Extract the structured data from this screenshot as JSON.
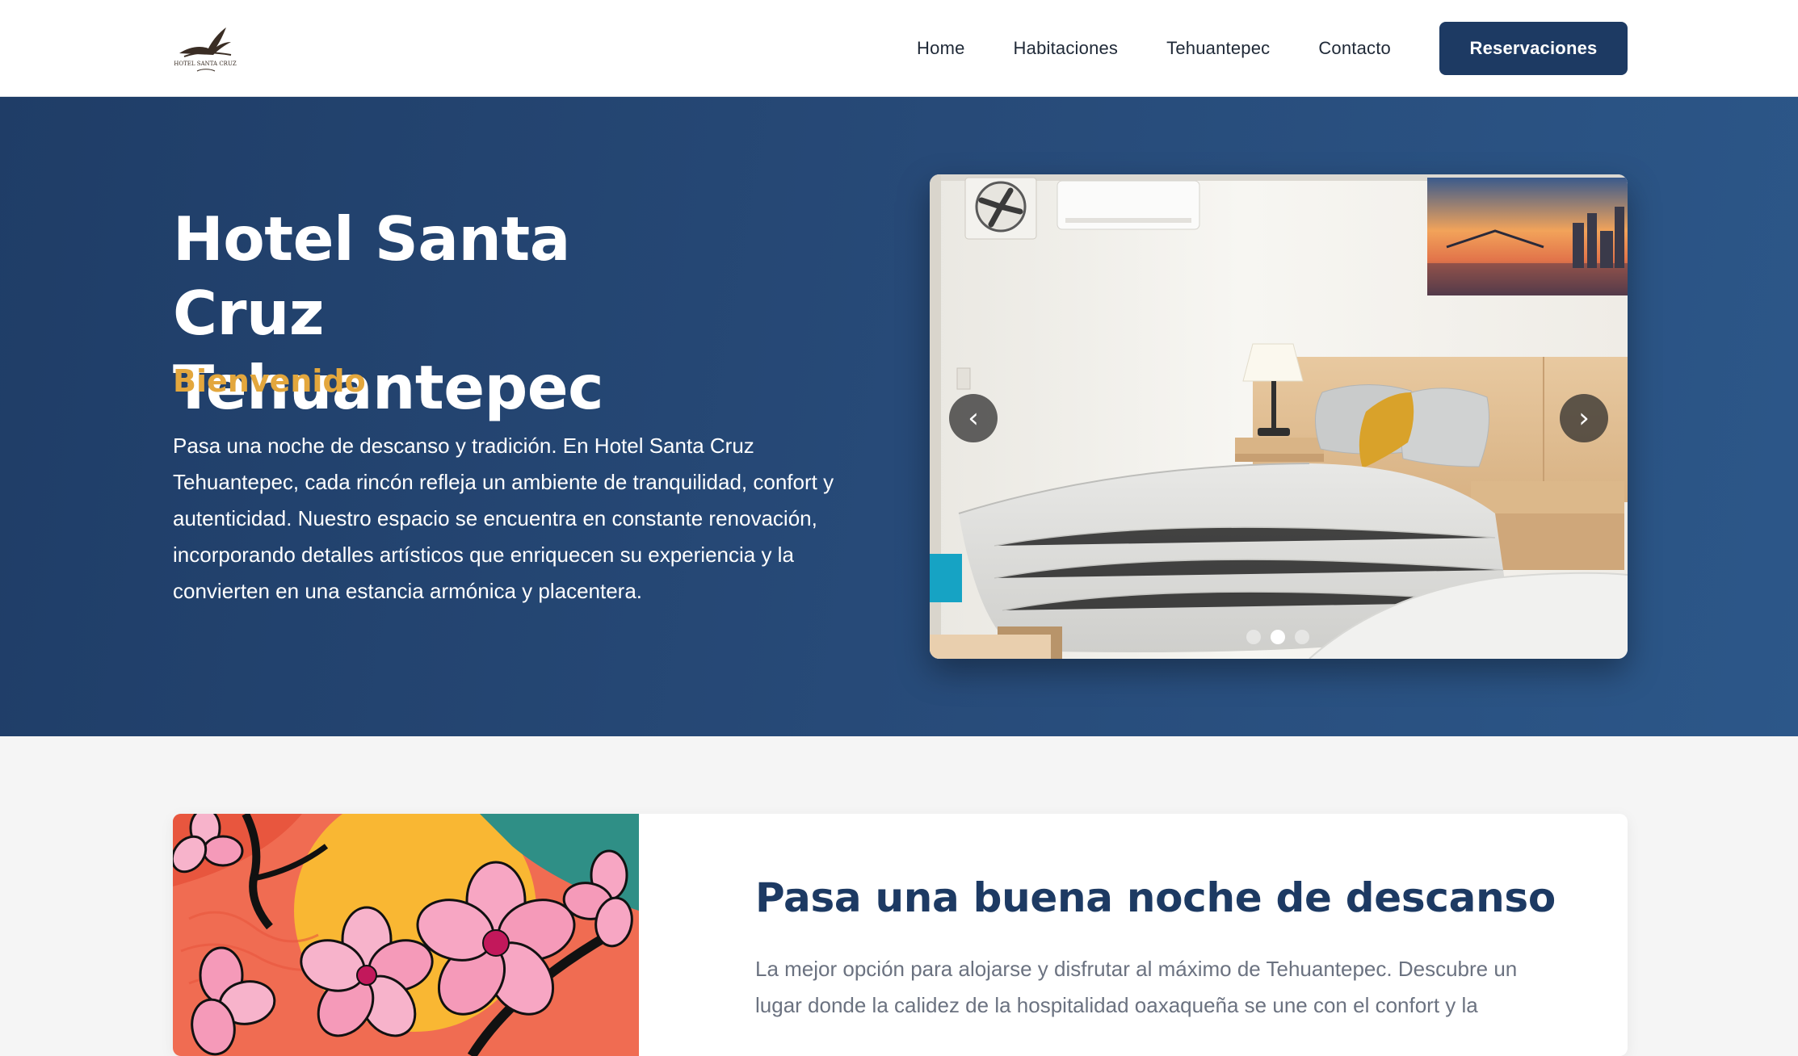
{
  "header": {
    "logo_text": "HOTEL SANTA CRUZ",
    "nav": [
      "Home",
      "Habitaciones",
      "Tehuantepec",
      "Contacto"
    ],
    "reserve_label": "Reservaciones"
  },
  "hero": {
    "title": "Hotel Santa Cruz Tehuantepec",
    "subtitle": "Bienvenido",
    "text": "Pasa una noche de descanso y tradición. En Hotel Santa Cruz Tehuantepec, cada rincón refleja un ambiente de tranquilidad, confort y autenticidad. Nuestro espacio se encuentra en constante renovación, incorporando detalles artísticos que enriquecen su experiencia y la convierten en una estancia armónica y placentera.",
    "carousel": {
      "prev_icon": "‹",
      "next_icon": "›",
      "slide_count": 3,
      "active_slide": 2
    }
  },
  "section2": {
    "title": "Pasa una buena noche de descanso",
    "text": "La mejor opción para alojarse y disfrutar al máximo de Tehuantepec. Descubre un lugar donde la calidez de la hospitalidad oaxaqueña se une con el confort y la"
  },
  "colors": {
    "brand_navy": "#1d3a63",
    "accent_gold": "#e3a73d",
    "hero_bg": "#274a78"
  }
}
